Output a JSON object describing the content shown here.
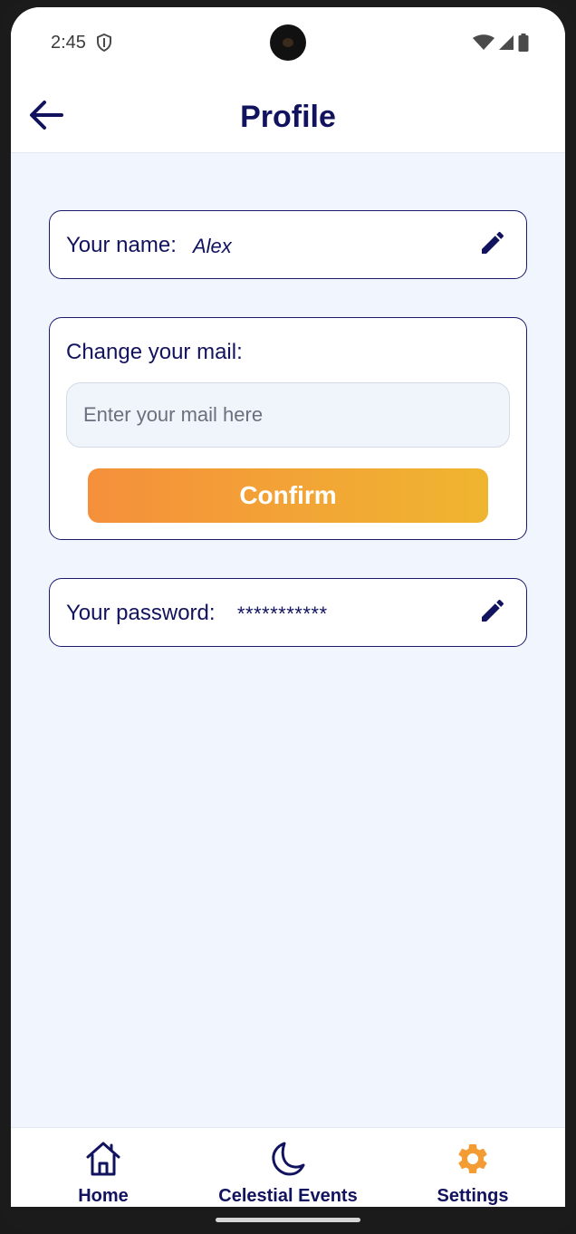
{
  "status_bar": {
    "time": "2:45",
    "icons": [
      "shield-icon",
      "wifi-icon",
      "signal-icon",
      "battery-icon"
    ]
  },
  "app_bar": {
    "title": "Profile",
    "back_icon": "arrow-left-icon"
  },
  "name_card": {
    "label": "Your name:",
    "value": "Alex",
    "edit_icon": "pencil-icon"
  },
  "mail_card": {
    "label": "Change your mail:",
    "input_value": "",
    "input_placeholder": "Enter your mail here",
    "confirm_label": "Confirm"
  },
  "password_card": {
    "label": "Your password:",
    "value": "***********",
    "edit_icon": "pencil-icon"
  },
  "bottom_nav": {
    "items": [
      {
        "label": "Home",
        "icon": "home-icon",
        "active": false
      },
      {
        "label": "Celestial Events",
        "icon": "moon-icon",
        "active": false
      },
      {
        "label": "Settings",
        "icon": "gear-icon",
        "active": true
      }
    ]
  },
  "colors": {
    "primary": "#12135e",
    "accent": "#f39c34",
    "background": "#f1f5fd",
    "surface": "#ffffff",
    "confirm_gradient_start": "#f58f3b",
    "confirm_gradient_end": "#efb52f"
  }
}
